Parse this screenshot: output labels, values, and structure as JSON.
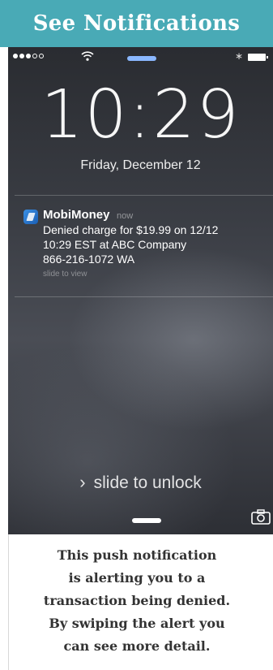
{
  "banner": {
    "title": "See Notifications"
  },
  "status_bar": {
    "wifi_icon": "wifi-icon",
    "bluetooth_icon": "bluetooth-icon",
    "battery_icon": "battery-icon"
  },
  "lock_screen": {
    "time": "10:29",
    "date": "Friday, December 12",
    "notification": {
      "app_name": "MobiMoney",
      "timestamp": "now",
      "message": "Denied charge for $19.99 on 12/12\n10:29 EST at  ABC Company\n866-216-1072 WA",
      "hint": "slide to view"
    },
    "unlock_chevron": "›",
    "unlock_label": "slide to unlock",
    "camera_icon": "camera-icon"
  },
  "caption": {
    "lines": [
      "This push notification",
      "is alerting you to a",
      "transaction being denied.",
      "By swiping the alert you",
      "can see more detail."
    ]
  }
}
